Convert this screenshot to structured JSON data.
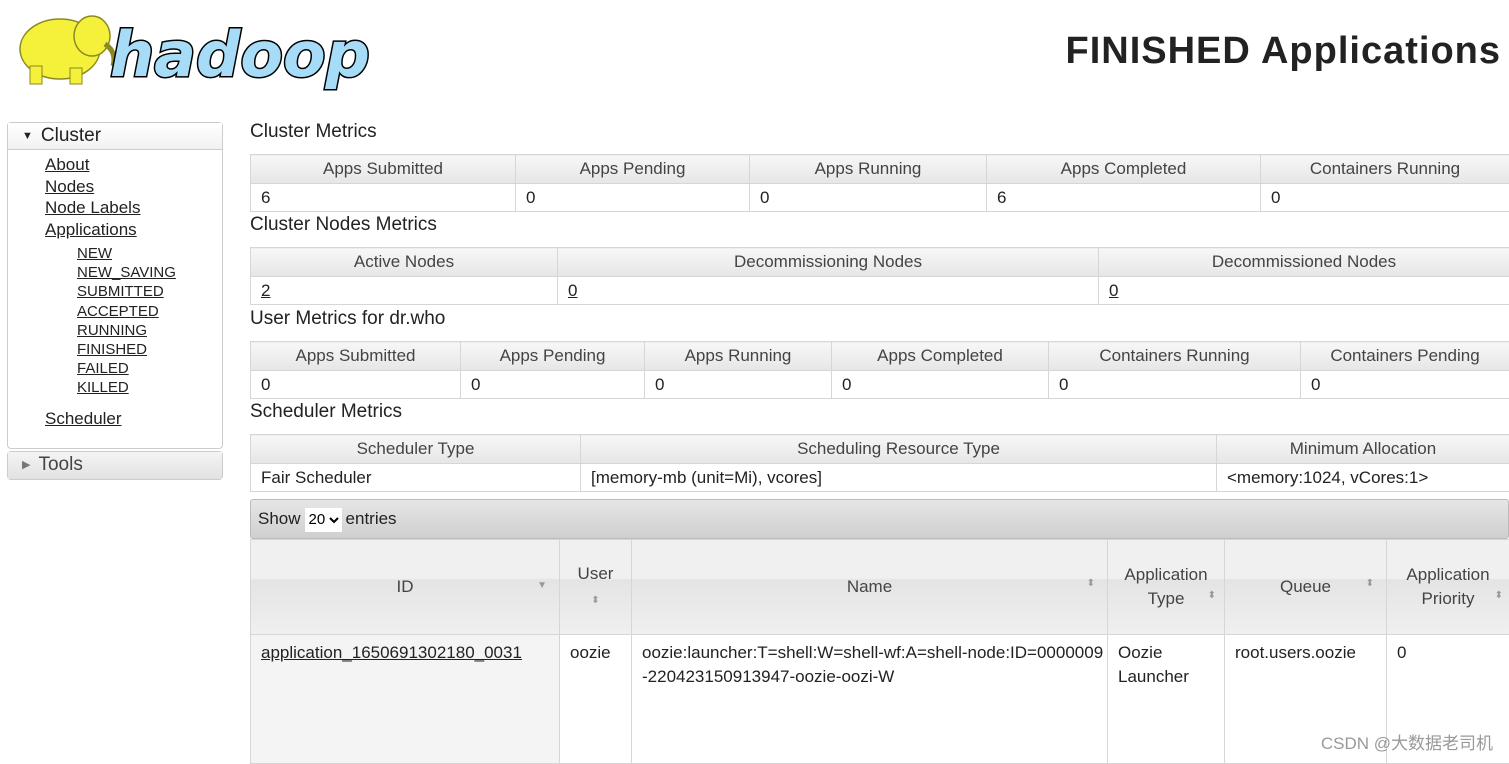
{
  "header": {
    "logo_text": "hadoop",
    "title": "FINISHED Applications"
  },
  "sidebar": {
    "cluster_label": "Cluster",
    "links": [
      "About",
      "Nodes",
      "Node Labels",
      "Applications"
    ],
    "app_states": [
      "NEW",
      "NEW_SAVING",
      "SUBMITTED",
      "ACCEPTED",
      "RUNNING",
      "FINISHED",
      "FAILED",
      "KILLED"
    ],
    "scheduler": "Scheduler",
    "tools_label": "Tools"
  },
  "cluster_metrics": {
    "title": "Cluster Metrics",
    "headers": [
      "Apps Submitted",
      "Apps Pending",
      "Apps Running",
      "Apps Completed",
      "Containers Running"
    ],
    "values": [
      "6",
      "0",
      "0",
      "6",
      "0"
    ]
  },
  "node_metrics": {
    "title": "Cluster Nodes Metrics",
    "headers": [
      "Active Nodes",
      "Decommissioning Nodes",
      "Decommissioned Nodes"
    ],
    "values": [
      "2",
      "0",
      "0"
    ]
  },
  "user_metrics": {
    "title": "User Metrics for dr.who",
    "headers": [
      "Apps Submitted",
      "Apps Pending",
      "Apps Running",
      "Apps Completed",
      "Containers Running",
      "Containers Pending"
    ],
    "values": [
      "0",
      "0",
      "0",
      "0",
      "0",
      "0"
    ]
  },
  "scheduler_metrics": {
    "title": "Scheduler Metrics",
    "headers": [
      "Scheduler Type",
      "Scheduling Resource Type",
      "Minimum Allocation"
    ],
    "values": [
      "Fair Scheduler",
      "[memory-mb (unit=Mi), vcores]",
      "<memory:1024, vCores:1>"
    ]
  },
  "apps_table": {
    "show_label": "Show",
    "entries_value": "20",
    "entries_label": "entries",
    "headers": [
      "ID",
      "User",
      "Name",
      "Application Type",
      "Queue",
      "Application Priority"
    ],
    "rows": [
      {
        "id": "application_1650691302180_0031",
        "user": "oozie",
        "name": "oozie:launcher:T=shell:W=shell-wf:A=shell-node:ID=0000009-220423150913947-oozie-oozi-W",
        "type": "Oozie Launcher",
        "queue": "root.users.oozie",
        "priority": "0"
      }
    ]
  },
  "watermark": "CSDN @大数据老司机"
}
